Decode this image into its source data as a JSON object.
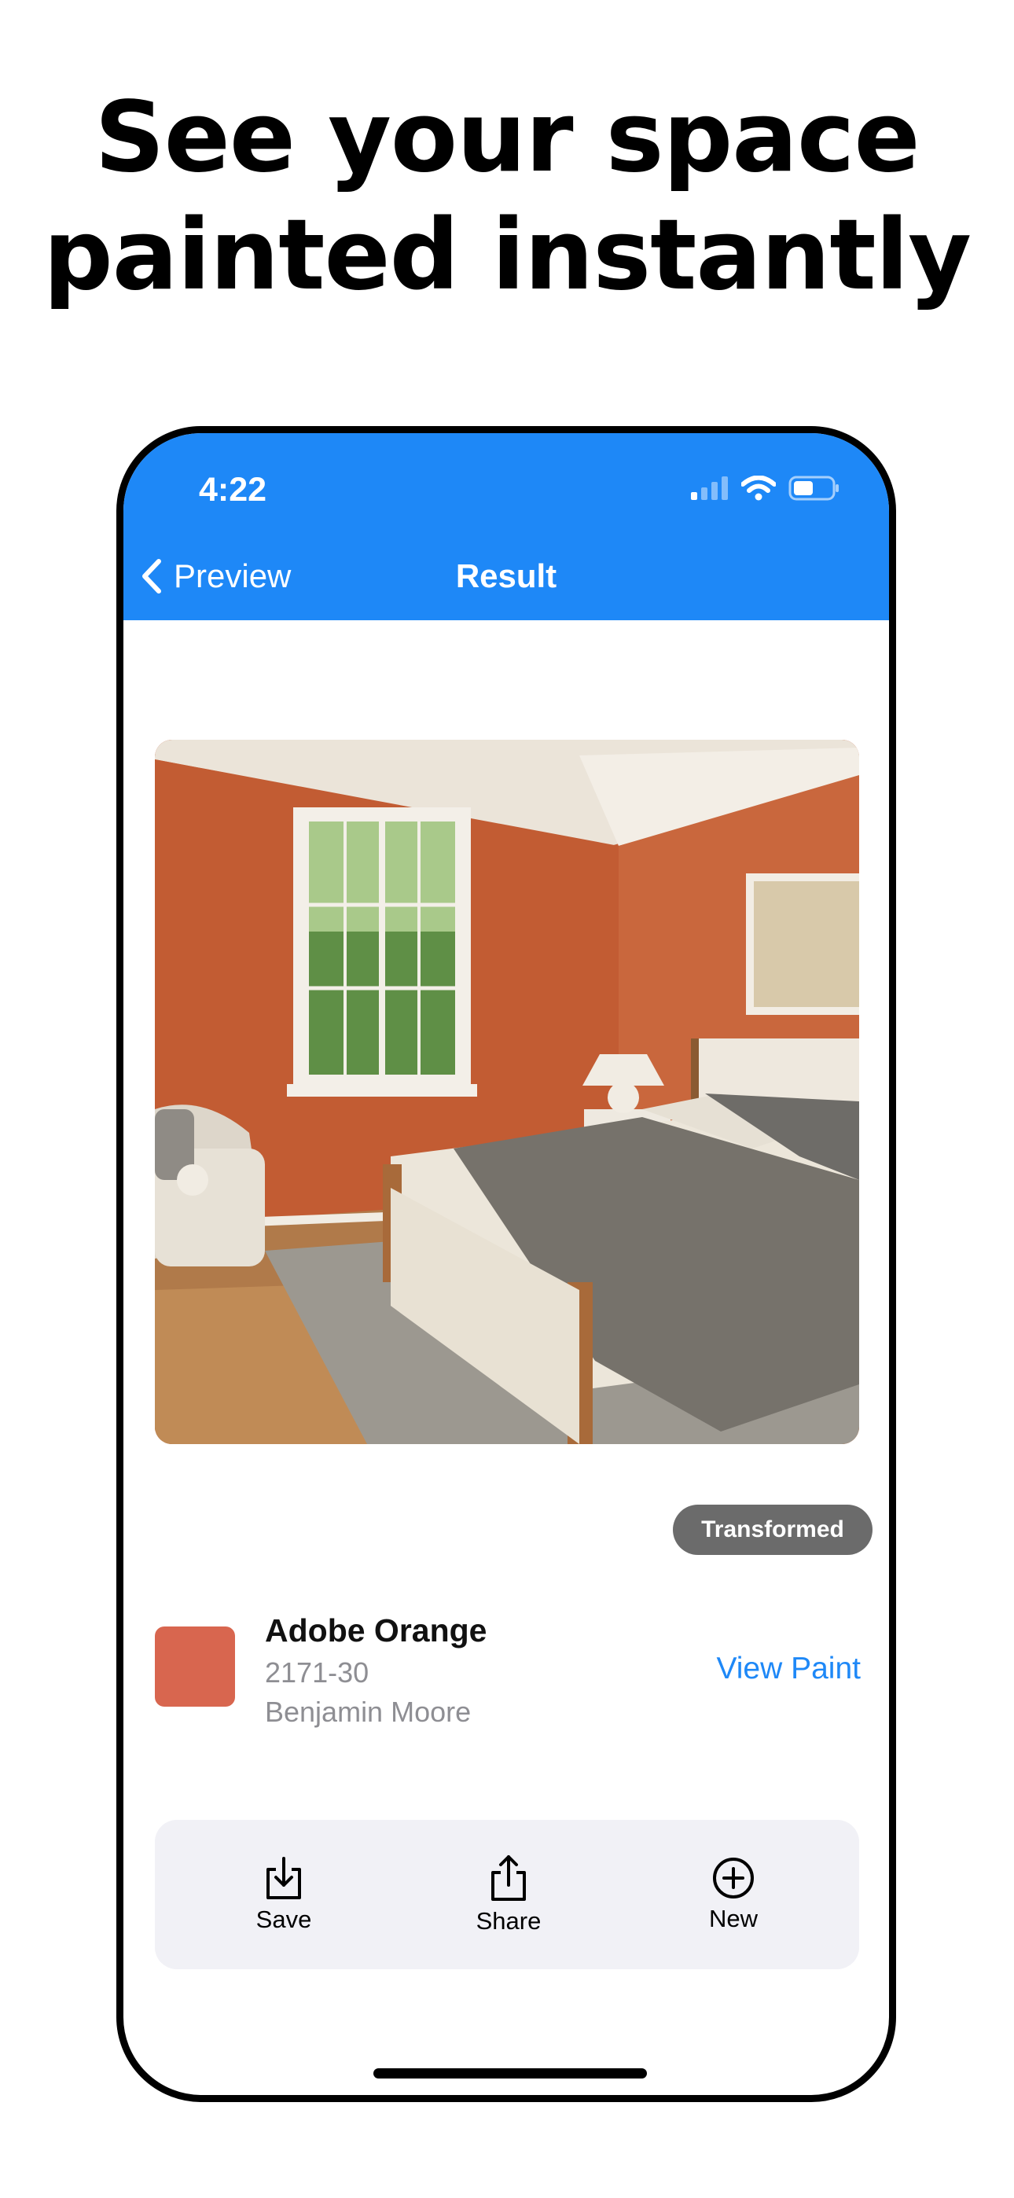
{
  "headline": {
    "line1": "See your space",
    "line2": "painted instantly"
  },
  "status_bar": {
    "time": "4:22"
  },
  "nav": {
    "back_label": "Preview",
    "title": "Result"
  },
  "result": {
    "badge": "Transformed",
    "paint": {
      "name": "Adobe Orange",
      "code": "2171-30",
      "brand": "Benjamin Moore",
      "swatch_color": "#d8664f",
      "link_label": "View Paint"
    }
  },
  "actions": [
    {
      "label": "Save",
      "icon": "save-icon"
    },
    {
      "label": "Share",
      "icon": "share-icon"
    },
    {
      "label": "New",
      "icon": "plus-circle-icon"
    }
  ],
  "colors": {
    "accent": "#1e88f7",
    "wall": "#c76339",
    "badge_bg": "#6b6b6b",
    "action_bar_bg": "#f1f1f6"
  }
}
